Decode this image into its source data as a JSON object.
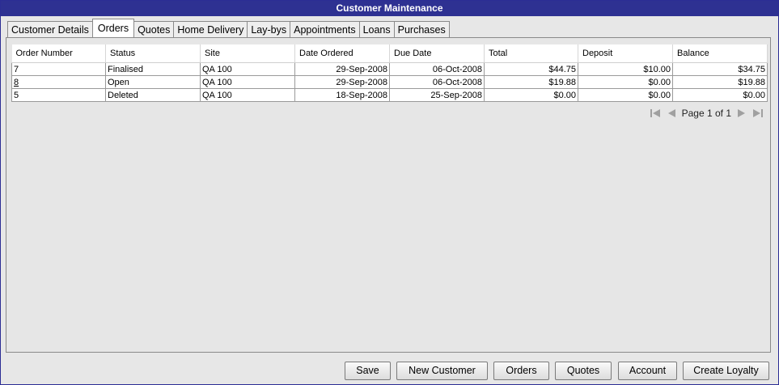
{
  "window": {
    "title": "Customer Maintenance"
  },
  "tabs": [
    {
      "label": "Customer Details"
    },
    {
      "label": "Orders"
    },
    {
      "label": "Quotes"
    },
    {
      "label": "Home Delivery"
    },
    {
      "label": "Lay-bys"
    },
    {
      "label": "Appointments"
    },
    {
      "label": "Loans"
    },
    {
      "label": "Purchases"
    }
  ],
  "active_tab": "Orders",
  "orders_table": {
    "columns": [
      "Order Number",
      "Status",
      "Site",
      "Date Ordered",
      "Due Date",
      "Total",
      "Deposit",
      "Balance"
    ],
    "rows": [
      {
        "order_number": "7",
        "status": "Finalised",
        "site": "QA 100",
        "date_ordered": "29-Sep-2008",
        "due_date": "06-Oct-2008",
        "total": "$44.75",
        "deposit": "$10.00",
        "balance": "$34.75"
      },
      {
        "order_number": "8",
        "status": "Open",
        "site": "QA 100",
        "date_ordered": "29-Sep-2008",
        "due_date": "06-Oct-2008",
        "total": "$19.88",
        "deposit": "$0.00",
        "balance": "$19.88"
      },
      {
        "order_number": "5",
        "status": "Deleted",
        "site": "QA 100",
        "date_ordered": "18-Sep-2008",
        "due_date": "25-Sep-2008",
        "total": "$0.00",
        "deposit": "$0.00",
        "balance": "$0.00"
      }
    ]
  },
  "pager": {
    "label": "Page 1 of 1",
    "icons": [
      "first-page-icon",
      "prev-page-icon",
      "next-page-icon",
      "last-page-icon"
    ]
  },
  "buttons": {
    "save": "Save",
    "new_customer": "New Customer",
    "orders": "Orders",
    "quotes": "Quotes",
    "account": "Account",
    "create_loyalty": "Create Loyalty"
  },
  "colors": {
    "titlebar": "#2e3192",
    "panel": "#e6e6e6",
    "pager_icon": "#a0a0a0"
  }
}
